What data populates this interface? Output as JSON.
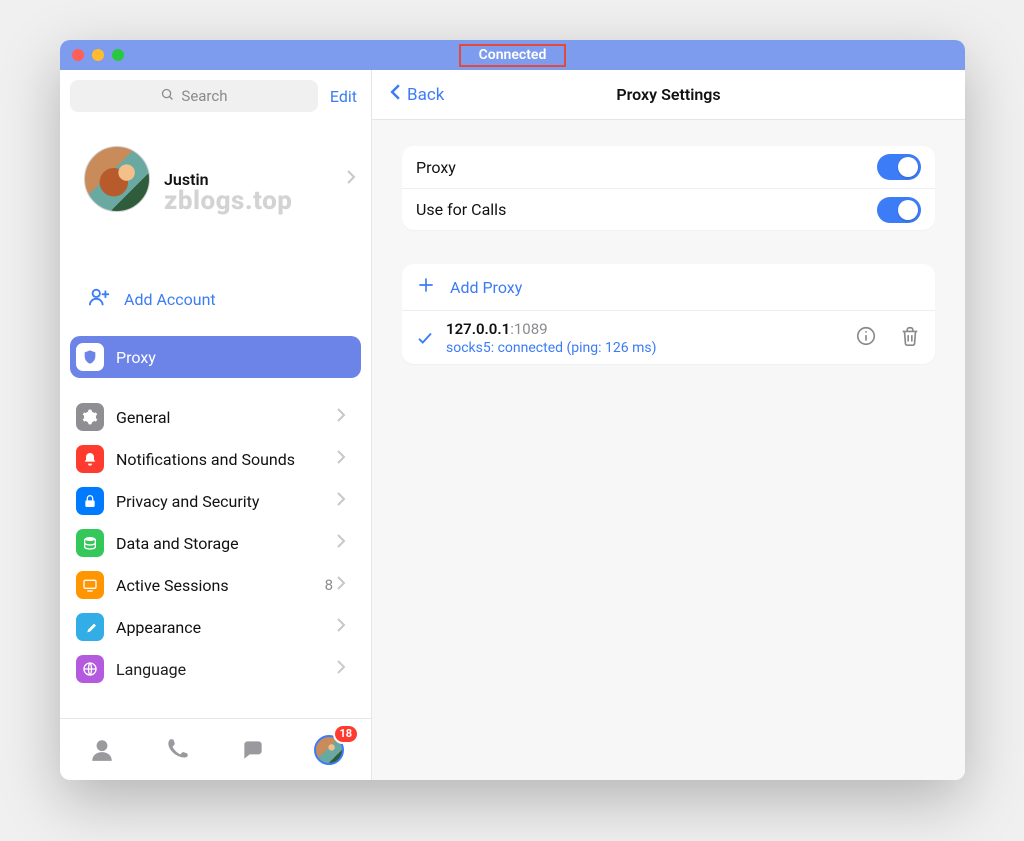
{
  "titlebar": {
    "status": "Connected"
  },
  "sidebar": {
    "search_placeholder": "Search",
    "edit_label": "Edit",
    "profile": {
      "name": "Justin"
    },
    "watermark": "zblogs.top",
    "add_account_label": "Add Account",
    "items": [
      {
        "id": "proxy",
        "label": "Proxy",
        "selected": true
      },
      {
        "id": "general",
        "label": "General",
        "selected": false
      },
      {
        "id": "notif",
        "label": "Notifications and Sounds",
        "selected": false
      },
      {
        "id": "privacy",
        "label": "Privacy and Security",
        "selected": false
      },
      {
        "id": "data",
        "label": "Data and Storage",
        "selected": false
      },
      {
        "id": "sessions",
        "label": "Active Sessions",
        "badge": "8",
        "selected": false
      },
      {
        "id": "appear",
        "label": "Appearance",
        "selected": false
      },
      {
        "id": "lang",
        "label": "Language",
        "selected": false
      }
    ]
  },
  "tabs": {
    "badge": "18"
  },
  "content": {
    "back_label": "Back",
    "title": "Proxy Settings",
    "toggles": {
      "proxy_label": "Proxy",
      "proxy_on": true,
      "calls_label": "Use for Calls",
      "calls_on": true
    },
    "add_proxy_label": "Add Proxy",
    "proxy": {
      "host": "127.0.0.1",
      "port": ":1089",
      "status": "socks5: connected (ping: 126 ms)"
    }
  }
}
